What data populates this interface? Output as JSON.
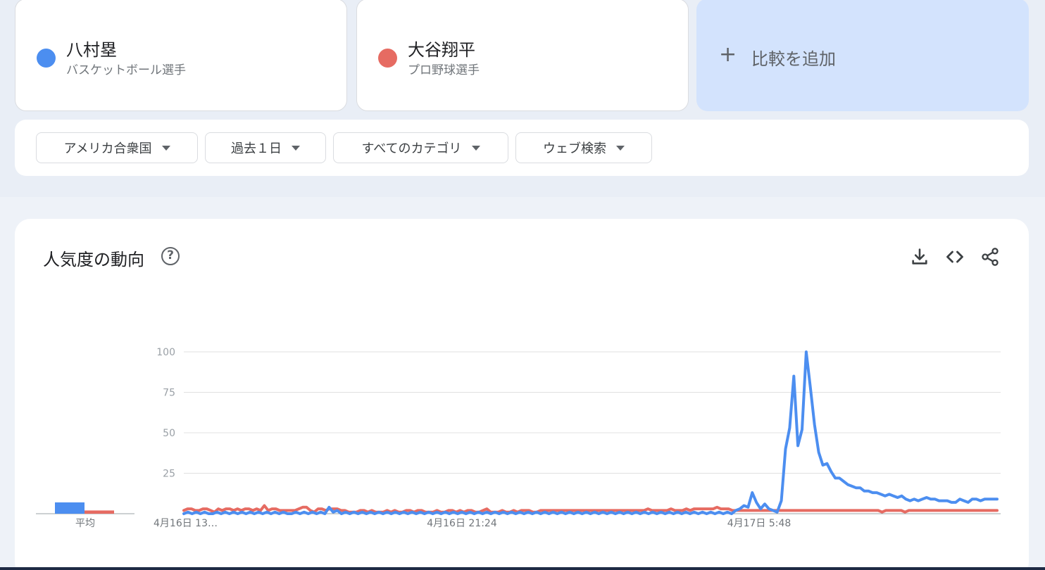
{
  "terms": [
    {
      "name": "八村塁",
      "description": "バスケットボール選手",
      "color": "#4c8ef0"
    },
    {
      "name": "大谷翔平",
      "description": "プロ野球選手",
      "color": "#e66b62"
    }
  ],
  "add_compare": {
    "label": "比較を追加",
    "icon": "plus-icon"
  },
  "filters": {
    "region": "アメリカ合衆国",
    "time": "過去１日",
    "category": "すべてのカテゴリ",
    "search_type": "ウェブ検索"
  },
  "chart_section": {
    "title": "人気度の動向",
    "help_icon": "question-mark-icon",
    "actions": [
      "download-icon",
      "embed-code-icon",
      "share-icon"
    ]
  },
  "chart_data": {
    "type": "line",
    "ylim": [
      0,
      100
    ],
    "yticks": [
      "100",
      "75",
      "50",
      "25"
    ],
    "grid": true,
    "x_tick_labels": [
      "4月16日 13…",
      "4月16日 21:24",
      "4月17日 5:48"
    ],
    "average_label": "平均",
    "averages": [
      {
        "name": "八村塁",
        "value": 7
      },
      {
        "name": "大谷翔平",
        "value": 2
      }
    ],
    "series": [
      {
        "name": "八村塁",
        "color": "#4c8ef0",
        "values": [
          0,
          1,
          0,
          1,
          0,
          1,
          0,
          0,
          1,
          0,
          1,
          0,
          1,
          0,
          1,
          0,
          1,
          0,
          1,
          0,
          1,
          0,
          1,
          0,
          1,
          0,
          0,
          1,
          0,
          1,
          0,
          1,
          0,
          1,
          0,
          4,
          1,
          2,
          0,
          1,
          0,
          1,
          0,
          1,
          0,
          1,
          0,
          1,
          0,
          1,
          0,
          1,
          0,
          1,
          0,
          1,
          0,
          1,
          0,
          1,
          0,
          1,
          0,
          1,
          0,
          1,
          0,
          1,
          0,
          1,
          0,
          1,
          0,
          1,
          0,
          1,
          0,
          1,
          0,
          1,
          0,
          1,
          0,
          1,
          0,
          1,
          0,
          1,
          0,
          1,
          0,
          1,
          0,
          1,
          0,
          1,
          0,
          1,
          0,
          1,
          0,
          1,
          0,
          1,
          0,
          1,
          0,
          1,
          0,
          1,
          0,
          1,
          0,
          1,
          0,
          1,
          0,
          1,
          0,
          1,
          0,
          1,
          0,
          1,
          0,
          1,
          0,
          1,
          0,
          1,
          0,
          1,
          0,
          2,
          3,
          5,
          4,
          13,
          7,
          3,
          6,
          3,
          2,
          1,
          8,
          40,
          53,
          85,
          42,
          52,
          100,
          78,
          55,
          38,
          30,
          31,
          26,
          22,
          22,
          20,
          18,
          17,
          16,
          16,
          14,
          14,
          13,
          13,
          12,
          11,
          12,
          11,
          10,
          11,
          9,
          8,
          9,
          8,
          9,
          10,
          9,
          9,
          8,
          8,
          8,
          7,
          7,
          9,
          8,
          7,
          9,
          9,
          8,
          9,
          9,
          9,
          9
        ]
      },
      {
        "name": "大谷翔平",
        "color": "#e66b62",
        "values": [
          2,
          3,
          3,
          2,
          2,
          3,
          3,
          2,
          1,
          3,
          2,
          3,
          3,
          2,
          3,
          2,
          3,
          3,
          2,
          3,
          2,
          5,
          2,
          3,
          3,
          2,
          2,
          2,
          2,
          2,
          3,
          4,
          4,
          2,
          1,
          3,
          3,
          2,
          3,
          3,
          3,
          2,
          2,
          1,
          1,
          1,
          2,
          2,
          1,
          2,
          1,
          1,
          1,
          2,
          1,
          2,
          1,
          1,
          2,
          2,
          1,
          2,
          2,
          1,
          1,
          1,
          2,
          1,
          1,
          2,
          2,
          1,
          2,
          1,
          2,
          2,
          1,
          1,
          2,
          3,
          1,
          1,
          1,
          2,
          1,
          1,
          2,
          1,
          2,
          2,
          2,
          1,
          1,
          2,
          2,
          2,
          2,
          2,
          2,
          2,
          2,
          2,
          2,
          2,
          2,
          2,
          2,
          2,
          2,
          2,
          2,
          2,
          2,
          2,
          2,
          2,
          2,
          2,
          2,
          2,
          2,
          3,
          2,
          2,
          2,
          2,
          2,
          3,
          2,
          2,
          2,
          3,
          2,
          3,
          3,
          3,
          3,
          3,
          3,
          4,
          3,
          3,
          3,
          2,
          2,
          2,
          2,
          2,
          2,
          2,
          2,
          2,
          2,
          2,
          2,
          2,
          2,
          2,
          2,
          2,
          2,
          2,
          2,
          2,
          2,
          2,
          2,
          2,
          2,
          2,
          2,
          2,
          2,
          2,
          2,
          2,
          2,
          2,
          2,
          2,
          2,
          2,
          1,
          2,
          2,
          2,
          2,
          2,
          1,
          2,
          2,
          2,
          2,
          2,
          2,
          2,
          2,
          2,
          2,
          2,
          2,
          2,
          2,
          2,
          2,
          2,
          2,
          2,
          2,
          2,
          2,
          2,
          2
        ]
      }
    ]
  }
}
